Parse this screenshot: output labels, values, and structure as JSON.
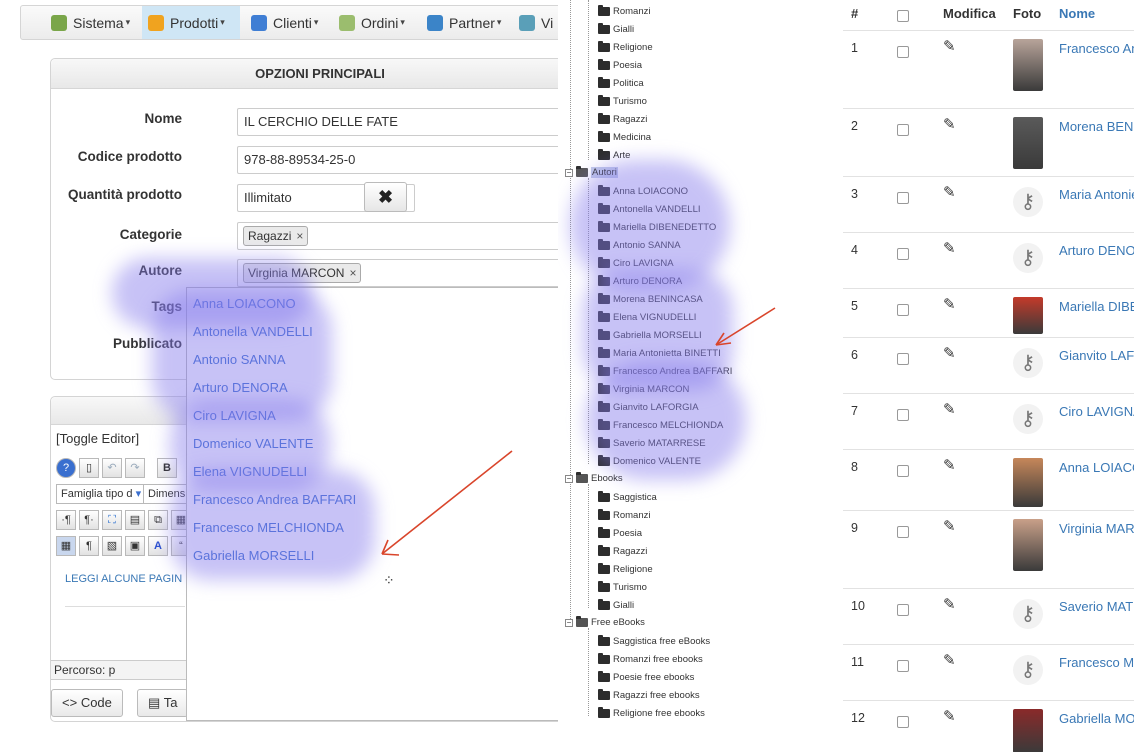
{
  "menu": {
    "items": [
      {
        "label": "Sistema",
        "icon": "wrench-icon"
      },
      {
        "label": "Prodotti",
        "icon": "box-icon",
        "active": true
      },
      {
        "label": "Clienti",
        "icon": "users-icon"
      },
      {
        "label": "Ordini",
        "icon": "document-icon"
      },
      {
        "label": "Partner",
        "icon": "partner-icon"
      },
      {
        "label": "Vi",
        "icon": "window-icon"
      }
    ]
  },
  "form": {
    "title": "OPZIONI PRINCIPALI",
    "labels": {
      "nome": "Nome",
      "codice": "Codice prodotto",
      "quantita": "Quantità prodotto",
      "categorie": "Categorie",
      "autore": "Autore",
      "tags": "Tags",
      "pubblicato": "Pubblicato"
    },
    "values": {
      "nome": "IL CERCHIO DELLE FATE",
      "codice": "978-88-89534-25-0",
      "quantita": "Illimitato"
    },
    "clear_icon": "✖",
    "categoria_tag": "Ragazzi",
    "autore_tag": "Virginia MARCON",
    "tag_remove": "×"
  },
  "dropdown": {
    "items": [
      "Anna LOIACONO",
      "Antonella VANDELLI",
      "Antonio SANNA",
      "Arturo DENORA",
      "Ciro LAVIGNA",
      "Domenico VALENTE",
      "Elena VIGNUDELLI",
      "Francesco Andrea BAFFARI",
      "Francesco MELCHIONDA",
      "Gabriella MORSELLI"
    ]
  },
  "editor": {
    "toggle": "[Toggle Editor]",
    "font_family": "Famiglia tipo d",
    "font_size": "Dimensi",
    "content_text": "LEGGI ALCUNE PAGIN",
    "path": "Percorso: p",
    "code_button": "Code",
    "table_button": "Ta"
  },
  "tree": {
    "top": [
      "Romanzi",
      "Gialli",
      "Religione",
      "Poesia",
      "Politica",
      "Turismo",
      "Ragazzi",
      "Medicina",
      "Arte"
    ],
    "autori_label": "Autori",
    "autori": [
      "Anna LOIACONO",
      "Antonella VANDELLI",
      "Mariella DIBENEDETTO",
      "Antonio SANNA",
      "Ciro LAVIGNA",
      "Arturo DENORA",
      "Morena BENINCASA",
      "Elena VIGNUDELLI",
      "Gabriella MORSELLI",
      "Maria Antonietta BINETTI",
      "Francesco Andrea BAFFARI",
      "Virginia MARCON",
      "Gianvito LAFORGIA",
      "Francesco MELCHIONDA",
      "Saverio MATARRESE",
      "Domenico VALENTE"
    ],
    "ebooks_label": "Ebooks",
    "ebooks": [
      "Saggistica",
      "Romanzi",
      "Poesia",
      "Ragazzi",
      "Religione",
      "Turismo",
      "Gialli"
    ],
    "free_label": "Free eBooks",
    "free": [
      "Saggistica free eBooks",
      "Romanzi free ebooks",
      "Poesie free ebooks",
      "Ragazzi free ebooks",
      "Religione free ebooks"
    ],
    "collapse_glyph": "−"
  },
  "table": {
    "headers": {
      "num": "#",
      "modifica": "Modifica",
      "foto": "Foto",
      "nome": "Nome"
    },
    "rows": [
      {
        "n": "1",
        "name": "Francesco An",
        "photo": "photo"
      },
      {
        "n": "2",
        "name": "Morena BEN",
        "photo": "photo"
      },
      {
        "n": "3",
        "name": "Maria Antonie",
        "photo": "key"
      },
      {
        "n": "4",
        "name": "Arturo DENO",
        "photo": "key"
      },
      {
        "n": "5",
        "name": "Mariella DIBE",
        "photo": "photo"
      },
      {
        "n": "6",
        "name": "Gianvito LAF",
        "photo": "key"
      },
      {
        "n": "7",
        "name": "Ciro LAVIGNA",
        "photo": "key"
      },
      {
        "n": "8",
        "name": "Anna LOIACO",
        "photo": "photo"
      },
      {
        "n": "9",
        "name": "Virginia MAR",
        "photo": "photo"
      },
      {
        "n": "10",
        "name": "Saverio MAT",
        "photo": "key"
      },
      {
        "n": "11",
        "name": "Francesco M",
        "photo": "key"
      },
      {
        "n": "12",
        "name": "Gabriella MO",
        "photo": "photo"
      }
    ]
  },
  "colors": {
    "highlight": "#8a7fe8",
    "arrow": "#d9452b",
    "link": "#3b6fcf"
  }
}
